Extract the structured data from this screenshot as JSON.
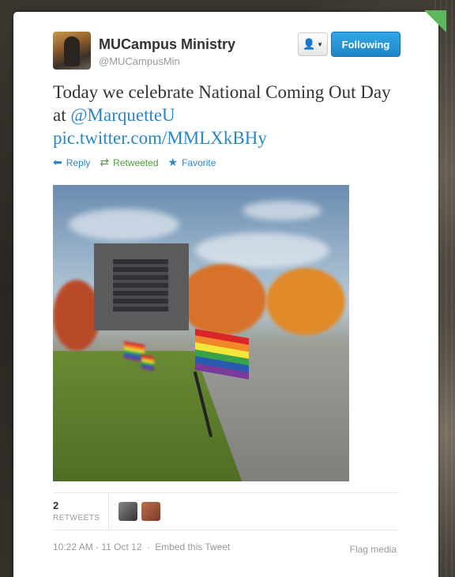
{
  "user": {
    "display_name": "MUCampus Ministry",
    "handle": "@MUCampusMin",
    "follow_label": "Following"
  },
  "tweet": {
    "text_part1": "Today we celebrate National Coming Out Day at ",
    "mention": "@MarquetteU",
    "link": "pic.twitter.com/MMLXkBHy"
  },
  "actions": {
    "reply": "Reply",
    "retweet": "Retweeted",
    "favorite": "Favorite"
  },
  "stats": {
    "retweet_count": "2",
    "retweet_label": "RETWEETS"
  },
  "footer": {
    "timestamp": "10:22 AM - 11 Oct 12",
    "separator": "·",
    "embed": "Embed this Tweet",
    "flag_media": "Flag media"
  },
  "colors": {
    "link": "#2a87c6",
    "follow_button": "#1f84c7",
    "retweeted": "#4a9a3a"
  }
}
